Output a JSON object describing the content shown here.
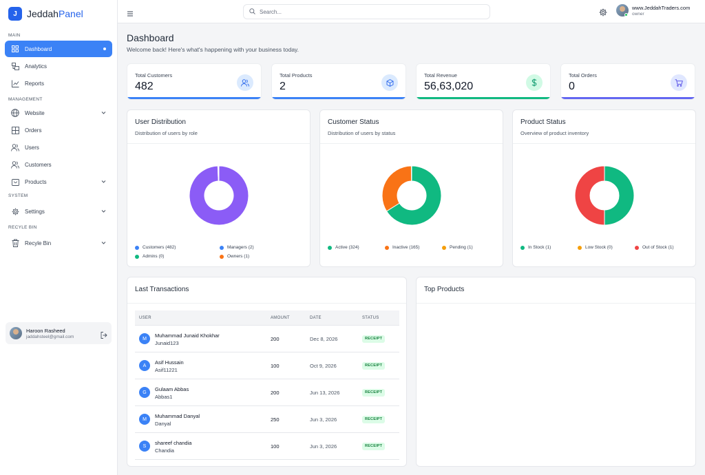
{
  "brand": {
    "logo_letter": "J",
    "name_part1": "Jeddah",
    "name_part2": "Panel"
  },
  "sidebar": {
    "sections": [
      {
        "label": "MAIN"
      },
      {
        "label": "MANAGEMENT"
      },
      {
        "label": "SYSTEM"
      },
      {
        "label": "RECYLE BIN"
      }
    ],
    "items": [
      {
        "label": "Dashboard",
        "icon": "grid-icon",
        "active": true
      },
      {
        "label": "Analytics",
        "icon": "analytics-icon"
      },
      {
        "label": "Reports",
        "icon": "chart-line-icon"
      },
      {
        "label": "Website",
        "icon": "globe-icon",
        "expandable": true
      },
      {
        "label": "Orders",
        "icon": "table-icon"
      },
      {
        "label": "Users",
        "icon": "users-icon"
      },
      {
        "label": "Customers",
        "icon": "users-icon"
      },
      {
        "label": "Products",
        "icon": "package-icon",
        "expandable": true
      },
      {
        "label": "Settings",
        "icon": "gear-icon",
        "expandable": true
      },
      {
        "label": "Recyle Bin",
        "icon": "trash-icon",
        "expandable": true
      }
    ],
    "user": {
      "name": "Haroon Rasheed",
      "email": "jaddahsteel@gmail.com"
    }
  },
  "topbar": {
    "search_placeholder": "Search...",
    "user_site": "www.JeddahTraders.com",
    "user_role": "owner"
  },
  "page": {
    "title": "Dashboard",
    "subtitle": "Welcome back! Here's what's happening with your business today."
  },
  "stats": [
    {
      "label": "Total Customers",
      "value": "482",
      "icon": "users-icon",
      "color": "#3b82f6",
      "icon_bg": "#dbeafe"
    },
    {
      "label": "Total Products",
      "value": "2",
      "icon": "box-icon",
      "color": "#3b82f6",
      "icon_bg": "#dbeafe"
    },
    {
      "label": "Total Revenue",
      "value": "56,63,020",
      "icon": "dollar-icon",
      "color": "#10b981",
      "icon_bg": "#d1fae5"
    },
    {
      "label": "Total Orders",
      "value": "0",
      "icon": "cart-icon",
      "color": "#6366f1",
      "icon_bg": "#e0e7ff"
    }
  ],
  "chart_data": [
    {
      "type": "pie",
      "title": "User Distribution",
      "subtitle": "Distribution of users by role",
      "categories": [
        "Customers (482)",
        "Managers (2)",
        "Admins (0)",
        "Owners (1)"
      ],
      "values": [
        482,
        2,
        0,
        1
      ],
      "colors": [
        "#8b5cf6",
        "#3b82f6",
        "#10b981",
        "#f97316"
      ],
      "legend_colors": [
        "#3b82f6",
        "#3b82f6",
        "#10b981",
        "#f97316"
      ]
    },
    {
      "type": "pie",
      "title": "Customer Status",
      "subtitle": "Distribution of users by status",
      "categories": [
        "Active (324)",
        "Inactive (165)",
        "Pending (1)"
      ],
      "values": [
        324,
        165,
        1
      ],
      "colors": [
        "#10b981",
        "#f97316",
        "#f59e0b"
      ],
      "legend_colors": [
        "#10b981",
        "#f97316",
        "#f59e0b"
      ]
    },
    {
      "type": "pie",
      "title": "Product Status",
      "subtitle": "Overview of product inventory",
      "categories": [
        "In Stock (1)",
        "Low Stock (0)",
        "Out of Stock (1)"
      ],
      "values": [
        1,
        0,
        1
      ],
      "colors": [
        "#10b981",
        "#f59e0b",
        "#ef4444"
      ],
      "legend_colors": [
        "#10b981",
        "#f59e0b",
        "#ef4444"
      ]
    }
  ],
  "transactions": {
    "title": "Last Transactions",
    "columns": [
      "USER",
      "AMOUNT",
      "DATE",
      "STATUS"
    ],
    "rows": [
      {
        "initial": "M",
        "name": "Muhammad Junaid Khokhar",
        "username": "Junaid123",
        "amount": "200",
        "date": "Dec 8, 2026",
        "status": "RECEIPT"
      },
      {
        "initial": "A",
        "name": "Asif Hussain",
        "username": "Asif11221",
        "amount": "100",
        "date": "Oct 9, 2026",
        "status": "RECEIPT"
      },
      {
        "initial": "G",
        "name": "Gulaam Abbas",
        "username": "Abbas1",
        "amount": "200",
        "date": "Jun 13, 2026",
        "status": "RECEIPT"
      },
      {
        "initial": "M",
        "name": "Muhammad Danyal",
        "username": "Danyal",
        "amount": "250",
        "date": "Jun 3, 2026",
        "status": "RECEIPT"
      },
      {
        "initial": "S",
        "name": "shareef chandia",
        "username": "Chandia",
        "amount": "100",
        "date": "Jun 3, 2026",
        "status": "RECEIPT"
      }
    ]
  },
  "top_products": {
    "title": "Top Products"
  }
}
